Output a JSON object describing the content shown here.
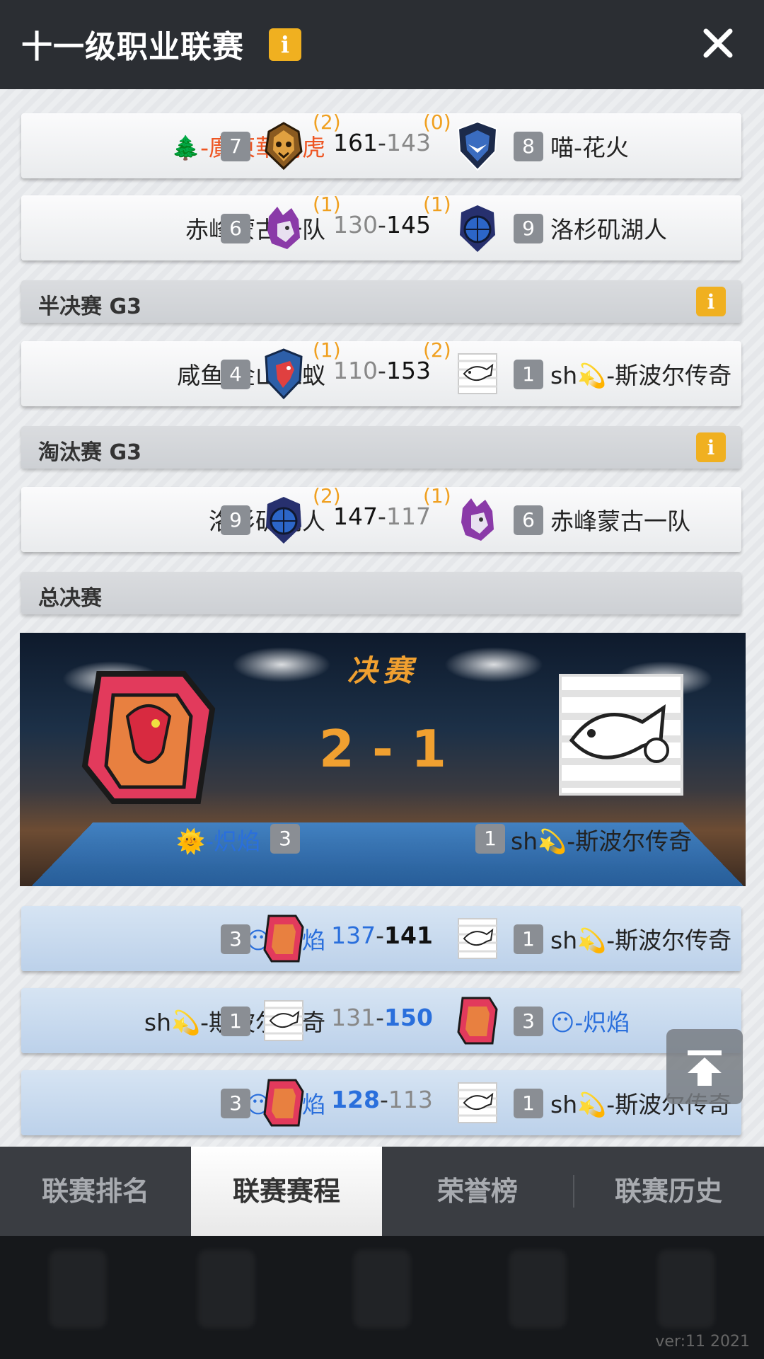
{
  "header": {
    "title": "十一级职业联赛",
    "info_label": "i"
  },
  "colors": {
    "accent": "#f0a020",
    "blue_team": "#2a6fdc",
    "orange_team": "#ee5522"
  },
  "matches_top": [
    {
      "left_name": "🌲-廣東華南虎",
      "left_seed": "7",
      "left_wins": "(2)",
      "left_score": "161",
      "right_score": "143",
      "right_wins": "(0)",
      "right_seed": "8",
      "right_name": "喵-花火"
    },
    {
      "left_name": "赤峰蒙古一队",
      "left_seed": "6",
      "left_wins": "(1)",
      "left_score": "130",
      "right_score": "145",
      "right_wins": "(1)",
      "right_seed": "9",
      "right_name": "洛杉矶湖人"
    }
  ],
  "sections": [
    {
      "label": "半决赛 G3",
      "info": "i"
    },
    {
      "label": "淘汰赛 G3",
      "info": "i"
    },
    {
      "label": "总决赛"
    }
  ],
  "semi_match": {
    "left_name": "咸鱼-金山红蚁",
    "left_seed": "4",
    "left_wins": "(1)",
    "left_score": "110",
    "right_score": "153",
    "right_wins": "(2)",
    "right_seed": "1",
    "right_name": "sh💫-斯波尔传奇"
  },
  "elim_match": {
    "left_name": "洛杉矶湖人",
    "left_seed": "9",
    "left_wins": "(2)",
    "left_score": "147",
    "right_score": "117",
    "right_wins": "(1)",
    "right_seed": "6",
    "right_name": "赤峰蒙古一队"
  },
  "final": {
    "title": "决赛",
    "score": "2 - 1",
    "left_name": "🌞-炽焰",
    "left_seed": "3",
    "right_seed": "1",
    "right_name": "sh💫-斯波尔传奇"
  },
  "final_games": [
    {
      "left_name": "😶-炽焰",
      "left_seed": "3",
      "left_score": "137",
      "right_score": "141",
      "right_seed": "1",
      "right_name": "sh💫-斯波尔传奇"
    },
    {
      "left_name": "sh💫-斯波尔传奇",
      "left_seed": "1",
      "left_score": "131",
      "right_score": "150",
      "right_seed": "3",
      "right_name": "😶-炽焰"
    },
    {
      "left_name": "😶-炽焰",
      "left_seed": "3",
      "left_score": "128",
      "right_score": "113",
      "right_seed": "1",
      "right_name": "sh💫-斯波尔传奇"
    }
  ],
  "tabs": [
    {
      "label": "联赛排名"
    },
    {
      "label": "联赛赛程",
      "active": true
    },
    {
      "label": "荣誉榜"
    },
    {
      "label": "联赛历史"
    }
  ],
  "footer": {
    "version": "ver:11  2021"
  }
}
